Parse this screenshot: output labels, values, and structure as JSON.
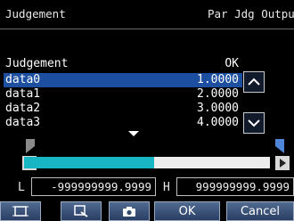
{
  "header": {
    "left": "Judgement",
    "right": "Par Jdg Output"
  },
  "list": {
    "column_name": "Judgement",
    "column_value": "OK",
    "rows": [
      {
        "name": "data0",
        "value": "1.0000",
        "selected": true
      },
      {
        "name": "data1",
        "value": "2.0000",
        "selected": false
      },
      {
        "name": "data2",
        "value": "3.0000",
        "selected": false
      },
      {
        "name": "data3",
        "value": "4.0000",
        "selected": false
      }
    ]
  },
  "slider": {
    "fill_fraction": 0.53,
    "track_color": "#ededed",
    "fill_color": "#18b6c4"
  },
  "range": {
    "lower_label": "L",
    "lower_value": "-999999999.9999",
    "upper_label": "H",
    "upper_value": "999999999.9999"
  },
  "footer": {
    "icons": [
      "frame-icon",
      "zoom-icon",
      "camera-icon"
    ],
    "ok_label": "OK",
    "cancel_label": "Cancel"
  },
  "colors": {
    "selection": "#1d4fa0",
    "button": "#3b5278",
    "accent": "#18b6c4"
  }
}
